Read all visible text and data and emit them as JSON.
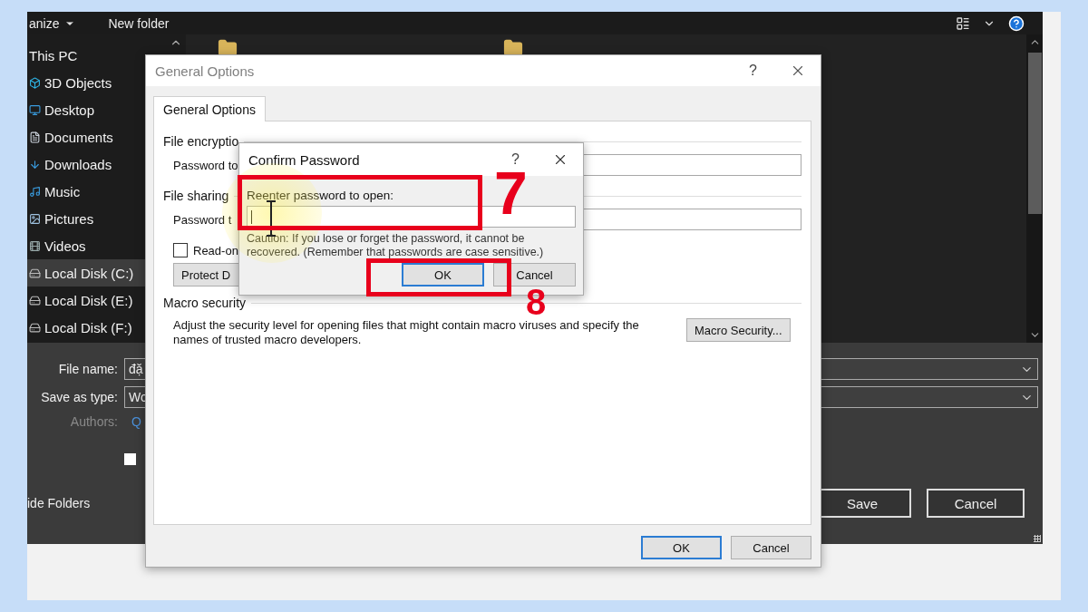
{
  "save_dialog": {
    "toolbar": {
      "organize": "anize",
      "new_folder": "New folder"
    },
    "nav": [
      {
        "label": "This PC",
        "kind": "root",
        "selected": false
      },
      {
        "label": "3D Objects",
        "kind": "cube",
        "selected": false
      },
      {
        "label": "Desktop",
        "kind": "desktop",
        "selected": false
      },
      {
        "label": "Documents",
        "kind": "documents",
        "selected": false
      },
      {
        "label": "Downloads",
        "kind": "downloads",
        "selected": false
      },
      {
        "label": "Music",
        "kind": "music",
        "selected": false
      },
      {
        "label": "Pictures",
        "kind": "pictures",
        "selected": false
      },
      {
        "label": "Videos",
        "kind": "videos",
        "selected": false
      },
      {
        "label": "Local Disk (C:)",
        "kind": "disk",
        "selected": true
      },
      {
        "label": "Local Disk (E:)",
        "kind": "disk",
        "selected": false
      },
      {
        "label": "Local Disk (F:)",
        "kind": "disk",
        "selected": false
      }
    ],
    "file_name": {
      "label": "File name:",
      "value": "đặ"
    },
    "save_as_type": {
      "label": "Save as type:",
      "value": "Wo"
    },
    "authors": {
      "label": "Authors:",
      "value": "Q"
    },
    "checkbox": {
      "checked": false
    },
    "hide_folders": "ide Folders",
    "buttons": [
      "Save",
      "Cancel"
    ]
  },
  "general_options": {
    "title": "General Options",
    "help": "?",
    "tab": {
      "label": "General Options",
      "selected": true
    },
    "encryption_heading": "File encryptio",
    "password_open_label": "Password to",
    "sharing_heading": "File sharing",
    "password_modify_label": "Password t",
    "read_only": {
      "label": "Read-on",
      "checked": false
    },
    "protect_button": "Protect D",
    "macro_heading": "Macro security",
    "macro_text": "Adjust the security level for opening files that might contain macro viruses and specify the names of trusted macro developers.",
    "macro_button": "Macro Security...",
    "buttons": [
      {
        "label": "OK",
        "default": true
      },
      {
        "label": "Cancel",
        "default": false
      }
    ]
  },
  "confirm_password": {
    "title": "Confirm Password",
    "help": "?",
    "prompt": "Reenter password to open:",
    "caution": "Caution: If you lose or forget the password, it cannot be recovered. (Remember that passwords are case sensitive.)",
    "buttons": [
      {
        "label": "OK",
        "default": true
      },
      {
        "label": "Cancel",
        "default": false
      }
    ]
  },
  "annotations": [
    {
      "label": "7"
    },
    {
      "label": "8"
    }
  ]
}
